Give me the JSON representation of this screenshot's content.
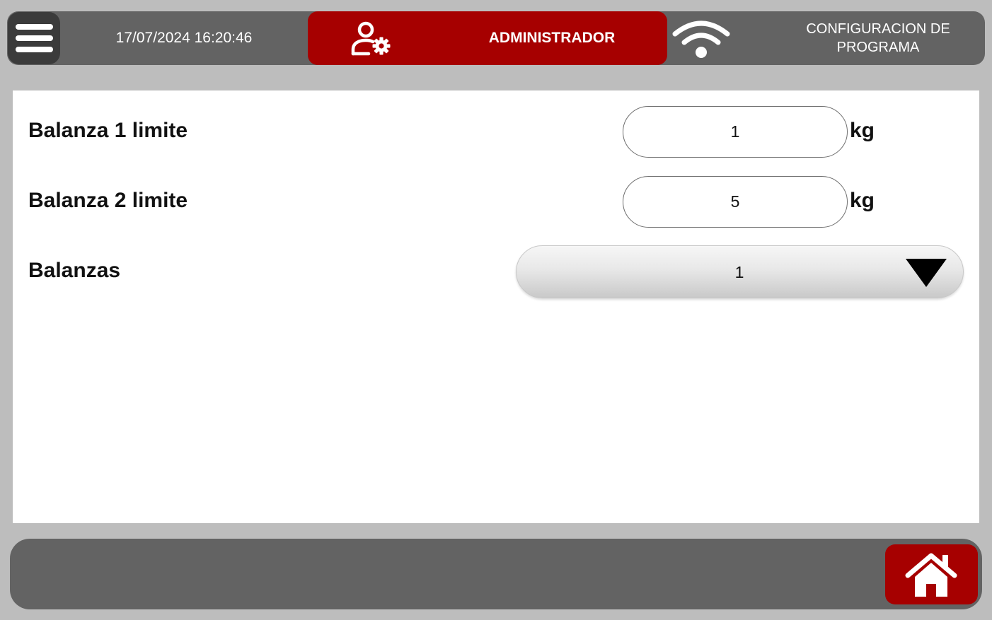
{
  "header": {
    "datetime": "17/07/2024 16:20:46",
    "user_role": "ADMINISTRADOR",
    "screen_title_line1": "CONFIGURACION DE",
    "screen_title_line2": "PROGRAMA",
    "icons": {
      "menu": "hamburger-menu-icon",
      "user": "user-settings-icon",
      "wifi": "wifi-icon"
    }
  },
  "settings": {
    "scale1": {
      "label": "Balanza 1 limite",
      "value": "1",
      "unit": "kg"
    },
    "scale2": {
      "label": "Balanza 2 limite",
      "value": "5",
      "unit": "kg"
    },
    "scales": {
      "label": "Balanzas",
      "selected": "1"
    }
  },
  "footer": {
    "icons": {
      "home": "home-icon"
    }
  },
  "colors": {
    "accent_red": "#a60000",
    "bar_gray": "#636363",
    "menu_dark": "#3b3b3b",
    "background": "#bdbdbd",
    "panel": "#ffffff"
  }
}
